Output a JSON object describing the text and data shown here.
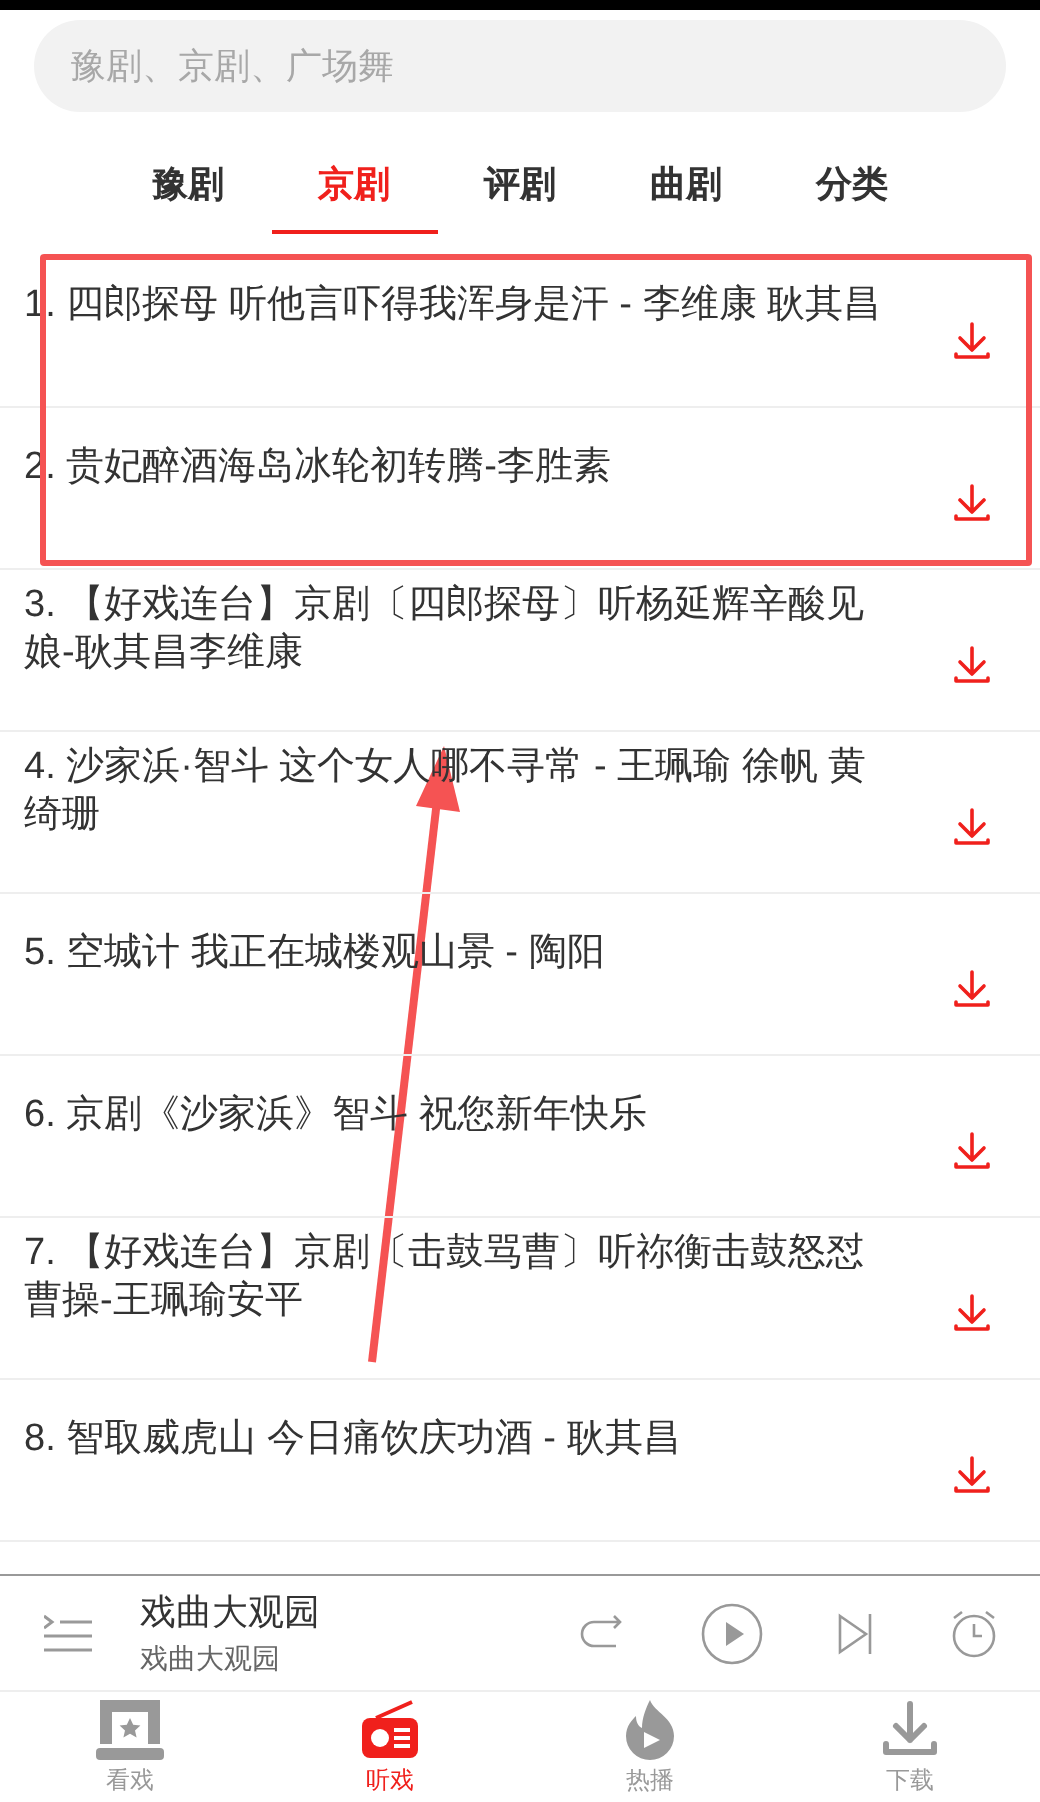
{
  "search": {
    "placeholder": "豫剧、京剧、广场舞"
  },
  "tabs": [
    {
      "label": "豫剧",
      "selected": false
    },
    {
      "label": "京剧",
      "selected": true
    },
    {
      "label": "评剧",
      "selected": false
    },
    {
      "label": "曲剧",
      "selected": false
    },
    {
      "label": "分类",
      "selected": false
    }
  ],
  "tracks": [
    {
      "title": "1. 四郎探母 听他言吓得我浑身是汗 - 李维康 耿其昌"
    },
    {
      "title": "2. 贵妃醉酒海岛冰轮初转腾-李胜素"
    },
    {
      "title": "3. 【好戏连台】京剧〔四郎探母〕听杨延辉辛酸见娘-耿其昌李维康"
    },
    {
      "title": "4. 沙家浜·智斗 这个女人哪不寻常 - 王珮瑜 徐帆 黄绮珊"
    },
    {
      "title": "5. 空城计 我正在城楼观山景 - 陶阳"
    },
    {
      "title": "6. 京剧《沙家浜》智斗 祝您新年快乐"
    },
    {
      "title": "7. 【好戏连台】京剧〔击鼓骂曹〕听祢衡击鼓怒怼曹操-王珮瑜安平"
    },
    {
      "title": "8. 智取威虎山 今日痛饮庆功酒 - 耿其昌"
    }
  ],
  "player": {
    "title": "戏曲大观园",
    "subtitle": "戏曲大观园"
  },
  "nav": [
    {
      "kind": "theater",
      "label": "看戏",
      "selected": false
    },
    {
      "kind": "radio",
      "label": "听戏",
      "selected": true
    },
    {
      "kind": "flame",
      "label": "热播",
      "selected": false
    },
    {
      "kind": "download",
      "label": "下载",
      "selected": false
    }
  ]
}
